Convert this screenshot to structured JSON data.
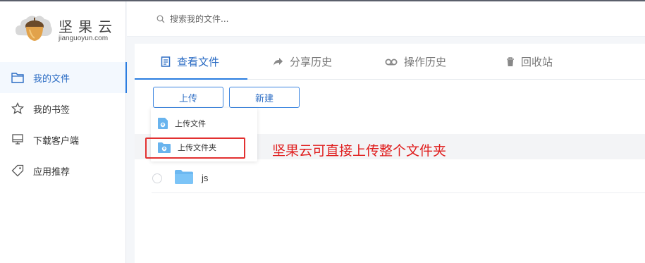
{
  "brand": {
    "name": "坚果云",
    "domain": "jianguoyun.com"
  },
  "sidebar": {
    "items": [
      {
        "label": "我的文件",
        "icon": "folder-icon",
        "active": true
      },
      {
        "label": "我的书签",
        "icon": "star-icon",
        "active": false
      },
      {
        "label": "下载客户端",
        "icon": "monitor-icon",
        "active": false
      },
      {
        "label": "应用推荐",
        "icon": "tag-icon",
        "active": false
      }
    ]
  },
  "header": {
    "search_placeholder": "搜索我的文件..."
  },
  "tabs": [
    {
      "label": "查看文件",
      "icon": "document-icon",
      "active": true
    },
    {
      "label": "分享历史",
      "icon": "share-icon",
      "active": false
    },
    {
      "label": "操作历史",
      "icon": "history-icon",
      "active": false
    },
    {
      "label": "回收站",
      "icon": "trash-icon",
      "active": false
    }
  ],
  "toolbar": {
    "upload_label": "上传",
    "new_label": "新建"
  },
  "upload_menu": {
    "items": [
      {
        "label": "上传文件",
        "icon": "upload-file-icon"
      },
      {
        "label": "上传文件夹",
        "icon": "upload-folder-icon"
      }
    ]
  },
  "annotation": {
    "text": "坚果云可直接上传整个文件夹",
    "color": "#e01e1e"
  },
  "files": [
    {
      "name": "js",
      "type": "folder"
    }
  ],
  "colors": {
    "accent": "#2b7de0",
    "annotation_red": "#e23131"
  }
}
